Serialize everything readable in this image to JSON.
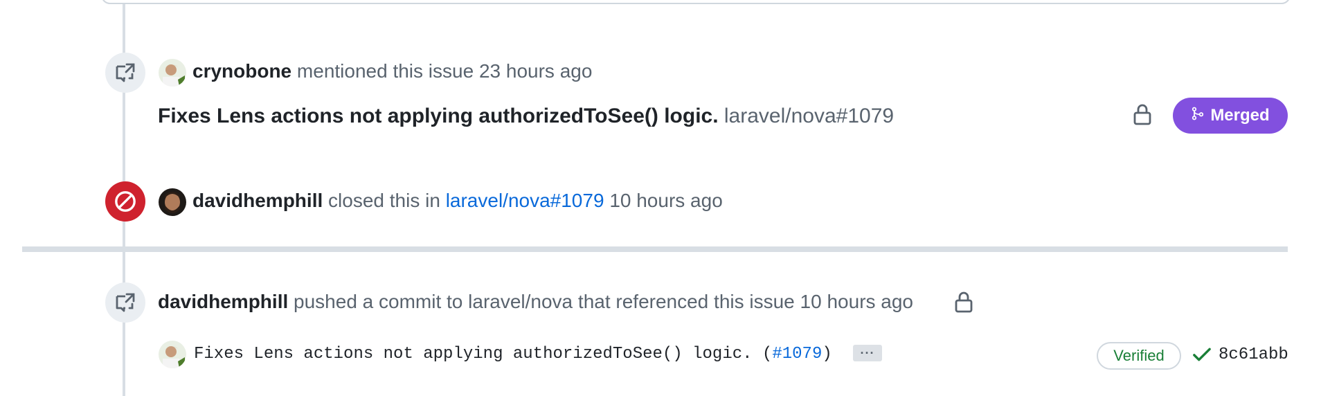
{
  "timeline": {
    "mention_event": {
      "icon": "cross-reference-icon",
      "user": "crynobone",
      "action": "mentioned this issue",
      "time": "23 hours ago",
      "referenced_title": "Fixes Lens actions not applying authorizedToSee() logic.",
      "referenced_ref": "laravel/nova#1079",
      "lock_icon": "lock-icon",
      "status_label": "Merged",
      "status_icon": "git-merge-icon",
      "status_color": "#8250df"
    },
    "closed_event": {
      "icon": "circle-slash-icon",
      "icon_color": "#cf222e",
      "user": "davidhemphill",
      "action": "closed this in",
      "ref_link": "laravel/nova#1079",
      "time": "10 hours ago"
    },
    "commit_event": {
      "icon": "cross-reference-icon",
      "user": "davidhemphill",
      "action": "pushed a commit to laravel/nova that referenced this issue",
      "time": "10 hours ago",
      "lock_icon": "lock-icon",
      "commit_message": "Fixes Lens actions not applying authorizedToSee() logic. (",
      "commit_pr_link": "#1079",
      "commit_message_end": ")",
      "ellipsis": "···",
      "verified_label": "Verified",
      "check_icon": "check-icon",
      "sha": "8c61abb"
    }
  },
  "colors": {
    "link": "#0969da",
    "verified": "#1a7f37",
    "muted": "#59636e"
  }
}
